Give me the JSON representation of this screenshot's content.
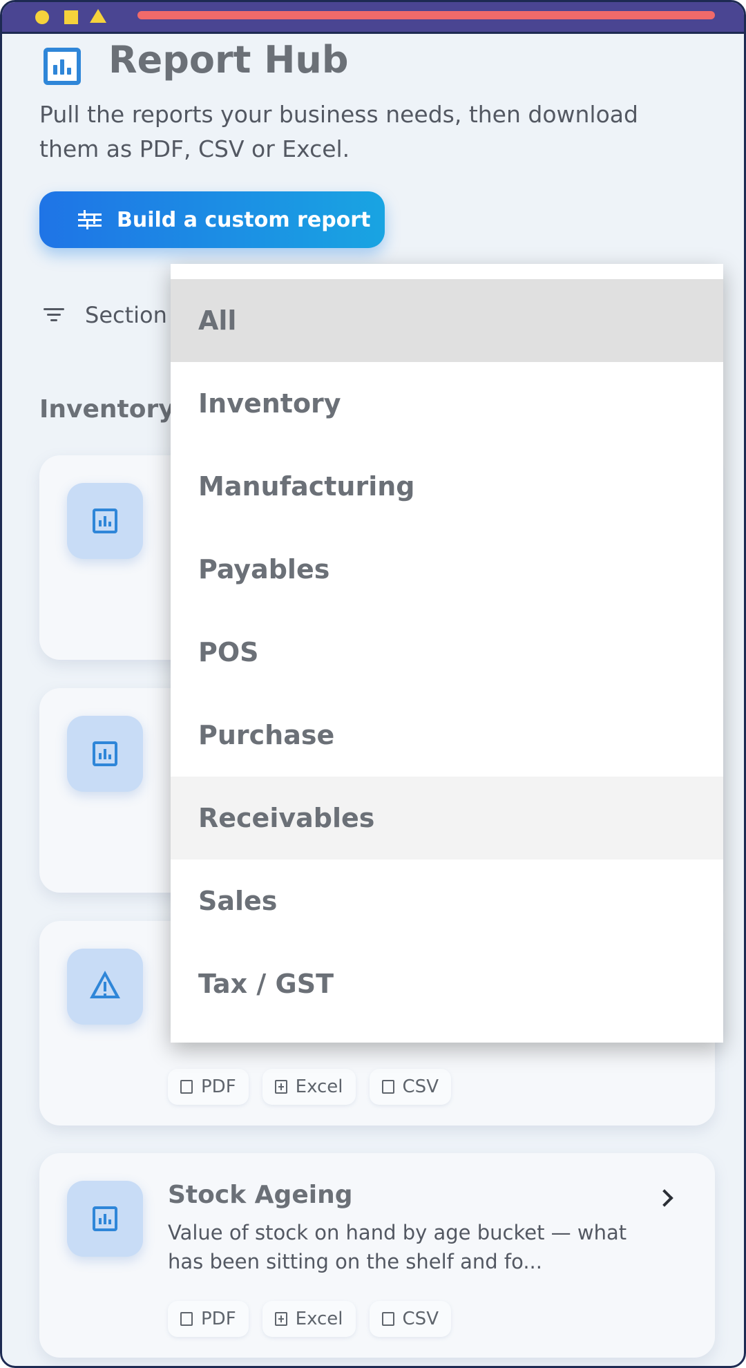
{
  "header": {
    "title": "Report Hub",
    "subtitle": "Pull the reports your business needs, then download them as PDF, CSV or Excel."
  },
  "actions": {
    "build_custom_report": "Build a custom report"
  },
  "filter": {
    "label": "Section"
  },
  "section": {
    "title": "Inventory"
  },
  "cards": [
    {
      "icon": "bar-chart-icon",
      "title": "",
      "description": ""
    },
    {
      "icon": "bar-chart-icon",
      "title": "",
      "description": ""
    },
    {
      "icon": "warning-icon",
      "title": "",
      "description": ""
    },
    {
      "icon": "bar-chart-icon",
      "title": "Stock Ageing",
      "description": "Value of stock on hand by age bucket — what has been sitting on the shelf and fo..."
    }
  ],
  "formats": {
    "pdf": "PDF",
    "excel": "Excel",
    "csv": "CSV"
  },
  "dropdown": {
    "selected": "All",
    "options": [
      "All",
      "Inventory",
      "Manufacturing",
      "Payables",
      "POS",
      "Purchase",
      "Receivables",
      "Sales",
      "Tax / GST"
    ]
  },
  "colors": {
    "accent": "#2f86d8",
    "button_gradient_start": "#1f74e6",
    "button_gradient_end": "#19a4e2",
    "titlebar": "#4a4592",
    "page_background": "#eef3f8"
  }
}
